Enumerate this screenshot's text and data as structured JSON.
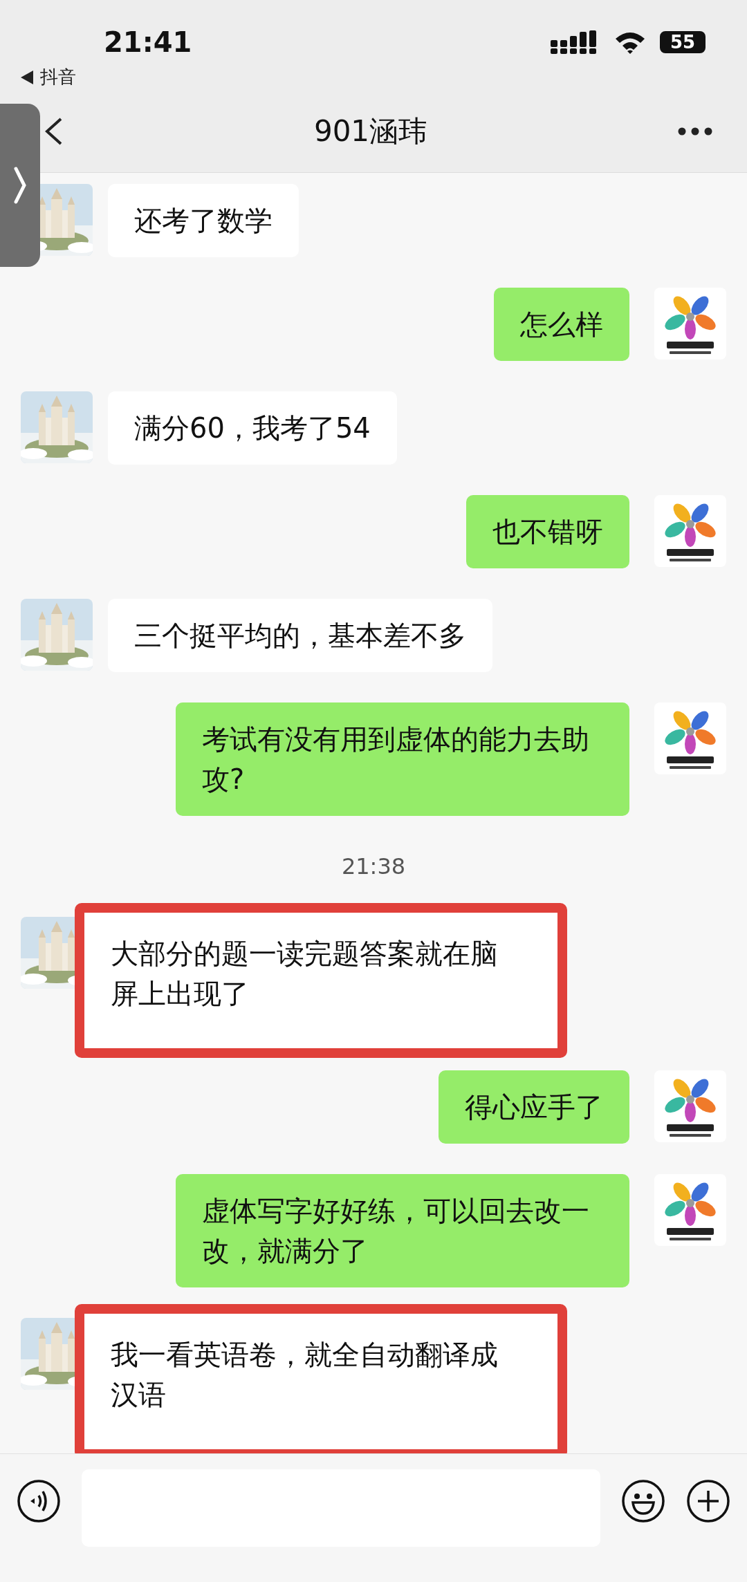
{
  "status_bar": {
    "time": "21:41",
    "back_app": "抖音",
    "battery": "55"
  },
  "nav": {
    "title": "901涵玮"
  },
  "messages": [
    {
      "kind": "incoming",
      "text": "还考了数学",
      "highlighted": false
    },
    {
      "kind": "outgoing",
      "text": "怎么样",
      "highlighted": false
    },
    {
      "kind": "incoming",
      "text": "满分60，我考了54",
      "highlighted": false
    },
    {
      "kind": "outgoing",
      "text": "也不错呀",
      "highlighted": false
    },
    {
      "kind": "incoming",
      "text": "三个挺平均的，基本差不多",
      "highlighted": false
    },
    {
      "kind": "outgoing",
      "text": "考试有没有用到虚体的能力去助攻?",
      "highlighted": false
    },
    {
      "kind": "time",
      "text": "21:38"
    },
    {
      "kind": "incoming",
      "text": "大部分的题一读完题答案就在脑屏上出现了",
      "highlighted": true
    },
    {
      "kind": "outgoing",
      "text": "得心应手了",
      "highlighted": false
    },
    {
      "kind": "outgoing",
      "text": "虚体写字好好练，可以回去改一改，就满分了",
      "highlighted": false
    },
    {
      "kind": "incoming",
      "text": "我一看英语卷，就全自动翻译成汉语",
      "highlighted": true
    }
  ]
}
